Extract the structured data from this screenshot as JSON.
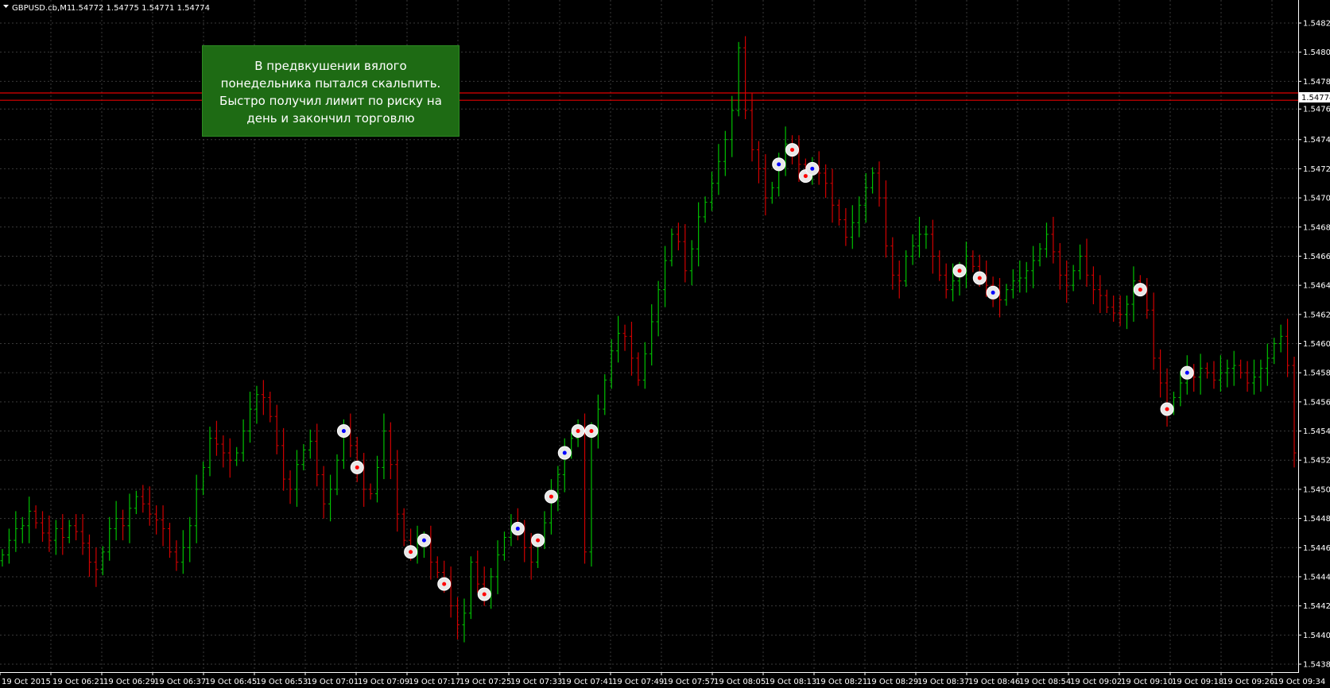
{
  "header": {
    "symbol": "GBPUSD.cb,M1",
    "ohlc": "1.54772 1.54775 1.54771 1.54774"
  },
  "note": {
    "text": "В предвкушении вялого понедельника пытался скальпить. Быстро получил лимит по риску на день и закончил торговлю"
  },
  "colors": {
    "background": "#000000",
    "grid": "#3a3a3a",
    "bull": "#00c000",
    "bear": "#d00000",
    "price_line": "#e00000",
    "note_bg": "#1e6b14"
  },
  "chart_data": {
    "type": "candlestick",
    "timeframe": "M1",
    "ylim": [
      1.54385,
      1.54835
    ],
    "y_ticks": [
      "1.54825",
      "1.54805",
      "1.54785",
      "1.54766",
      "1.54745",
      "1.54725",
      "1.54705",
      "1.54685",
      "1.54665",
      "1.54645",
      "1.54625",
      "1.54605",
      "1.54585",
      "1.54565",
      "1.54545",
      "1.54525",
      "1.54505",
      "1.54485",
      "1.54465",
      "1.54445",
      "1.54425",
      "1.54405",
      "1.54385"
    ],
    "x_ticks": [
      "19 Oct 2015",
      "19 Oct 06:21",
      "19 Oct 06:29",
      "19 Oct 06:37",
      "19 Oct 06:45",
      "19 Oct 06:53",
      "19 Oct 07:01",
      "19 Oct 07:09",
      "19 Oct 07:17",
      "19 Oct 07:25",
      "19 Oct 07:33",
      "19 Oct 07:41",
      "19 Oct 07:49",
      "19 Oct 07:57",
      "19 Oct 08:05",
      "19 Oct 08:13",
      "19 Oct 08:21",
      "19 Oct 08:29",
      "19 Oct 08:37",
      "19 Oct 08:46",
      "19 Oct 08:54",
      "19 Oct 09:02",
      "19 Oct 09:10",
      "19 Oct 09:18",
      "19 Oct 09:26",
      "19 Oct 09:34"
    ],
    "current_price": "1.54774",
    "price_lines": [
      1.54777,
      1.54772
    ],
    "closes": [
      1.5446,
      1.5447,
      1.54478,
      1.5448,
      1.5449,
      1.54482,
      1.54475,
      1.5447,
      1.54478,
      1.54472,
      1.5448,
      1.54476,
      1.54468,
      1.54455,
      1.5445,
      1.54462,
      1.54478,
      1.54485,
      1.5448,
      1.54492,
      1.545,
      1.54495,
      1.54488,
      1.54484,
      1.54478,
      1.54462,
      1.54455,
      1.54465,
      1.5448,
      1.54505,
      1.5452,
      1.5454,
      1.54536,
      1.5453,
      1.54525,
      1.5453,
      1.54545,
      1.5456,
      1.5457,
      1.54568,
      1.54555,
      1.54535,
      1.54512,
      1.54505,
      1.54522,
      1.54532,
      1.54538,
      1.54515,
      1.54495,
      1.54505,
      1.54525,
      1.54545,
      1.54535,
      1.5452,
      1.54505,
      1.54502,
      1.5452,
      1.54545,
      1.54522,
      1.54488,
      1.5447,
      1.54462,
      1.54468,
      1.5447,
      1.54455,
      1.54448,
      1.5444,
      1.54425,
      1.54412,
      1.5442,
      1.54455,
      1.5444,
      1.54433,
      1.54445,
      1.5446,
      1.54472,
      1.5448,
      1.54478,
      1.54465,
      1.54455,
      1.5447,
      1.54482,
      1.545,
      1.54515,
      1.5453,
      1.5454,
      1.54545,
      1.54462,
      1.54545,
      1.5456,
      1.5458,
      1.546,
      1.54612,
      1.5461,
      1.54595,
      1.5458,
      1.54598,
      1.5462,
      1.54642,
      1.54662,
      1.5468,
      1.54675,
      1.54655,
      1.5467,
      1.54692,
      1.54702,
      1.54715,
      1.5473,
      1.54745,
      1.54765,
      1.54808,
      1.54765,
      1.54738,
      1.54725,
      1.54705,
      1.54712,
      1.54728,
      1.54742,
      1.54738,
      1.54728,
      1.5472,
      1.54725,
      1.54722,
      1.54715,
      1.547,
      1.5469,
      1.54678,
      1.54688,
      1.547,
      1.54712,
      1.54722,
      1.54705,
      1.54672,
      1.54652,
      1.54648,
      1.54665,
      1.54672,
      1.5468,
      1.5468,
      1.54665,
      1.54652,
      1.54642,
      1.54648,
      1.54655,
      1.54665,
      1.54658,
      1.5465,
      1.54645,
      1.5464,
      1.54635,
      1.54642,
      1.54648,
      1.5465,
      1.54655,
      1.54662,
      1.5467,
      1.5468,
      1.54668,
      1.54652,
      1.54645,
      1.54655,
      1.54665,
      1.54652,
      1.54642,
      1.54638,
      1.5463,
      1.54626,
      1.54625,
      1.54632,
      1.54648,
      1.54642,
      1.54628,
      1.54595,
      1.54578,
      1.5456,
      1.54568,
      1.54578,
      1.54585,
      1.54582,
      1.54588,
      1.54585,
      1.5458,
      1.54585,
      1.54588,
      1.5459,
      1.54585,
      1.54578,
      1.54582,
      1.54588,
      1.54595,
      1.54605,
      1.5461,
      1.5459,
      1.5453
    ]
  }
}
